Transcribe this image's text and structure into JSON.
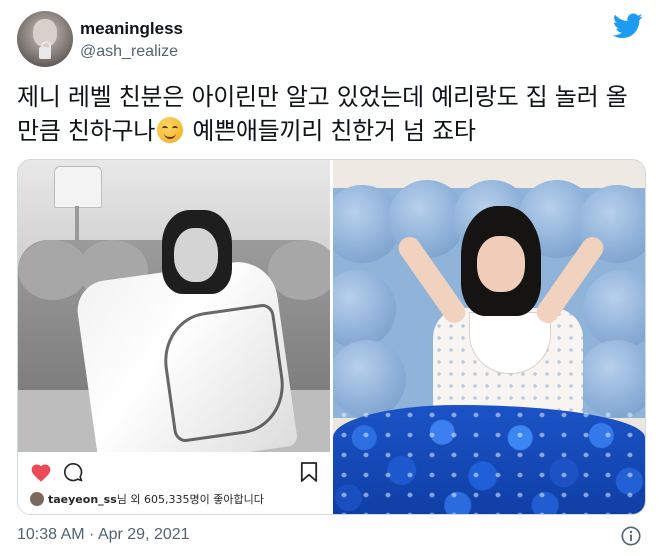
{
  "author": {
    "display_name": "meaningless",
    "handle": "@ash_realize"
  },
  "tweet": {
    "text_part1": "제니 레벨 친분은 아이린만 알고 있었는데 예리랑도 집 놀러 올 만큼 친하구나",
    "text_part2": " 예쁜애들끼리 친한거 넘 죠타",
    "emoji": "smiling-face-with-smiling-eyes"
  },
  "media": {
    "left_photo": {
      "likes_user": "taeyeon_ss",
      "likes_text": "님 외 605,335명이 좋아합니다"
    }
  },
  "footer": {
    "timestamp": "10:38 AM · Apr 29, 2021"
  },
  "colors": {
    "brand_blue": "#1d9bf0",
    "heart_red": "#ed4956",
    "secondary_text": "#536471"
  }
}
